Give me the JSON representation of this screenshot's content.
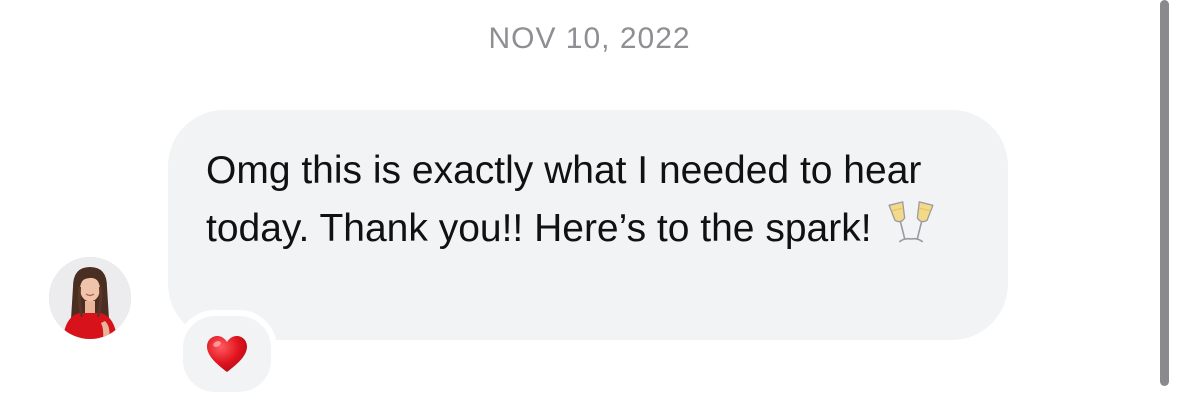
{
  "conversation": {
    "date_stamp": "NOV 10, 2022"
  },
  "message": {
    "sender_avatar_icon": "profile-photo-avatar",
    "text": "Omg this is exactly what I needed to hear today. Thank you!! Here’s to the spark!",
    "emoji_icon": "clinking-glasses-icon",
    "reaction_icon": "red-heart-icon"
  },
  "colors": {
    "bubble": "#f2f3f5",
    "date_text": "#8e8e93",
    "message_text": "#111111",
    "heart": "#e0141e",
    "scrollbar": "#8a8a8e"
  }
}
